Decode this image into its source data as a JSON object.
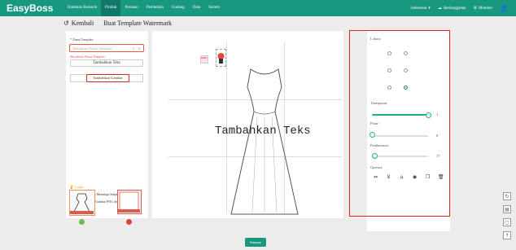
{
  "brand": "EasyBoss",
  "nav": [
    "Halaman Beranda",
    "Produk",
    "Pesanan",
    "Pembelian",
    "Gudang",
    "Data",
    "Sistem"
  ],
  "nav_active": 1,
  "right_nav": {
    "language": "Indonesia",
    "subscribe": "Berlanggahan",
    "member": "Member"
  },
  "header": {
    "back_label": "Kembali",
    "title": "Buat Template Watermark"
  },
  "left": {
    "name_label": "* Nama Template:",
    "name_placeholder": "Masukkan Nama Template",
    "name_counter": "0 / 30",
    "name_error": "Masukkan Nama Template",
    "add_text": "Tambahkan Teks",
    "add_image": "Tambahkan Gambar",
    "tips_title": "Cepat",
    "tips": [
      "1. Coba untuk Tidak Menutupi Subjek Produk dengan Tanda Air",
      "2. Unggah JPG dan Gambar PNG dengan Ukuran 2M"
    ]
  },
  "canvas": {
    "watermark_text": "Tambahkan Teks"
  },
  "right": {
    "location_label": "Lokasi:",
    "transparency_label": "Transparan:",
    "transparency_value": "1",
    "transparency_fraction": 1,
    "rotate_label": "Putar:",
    "rotate_value": "0",
    "rotate_fraction": 0,
    "scale_label": "Pembesaran:",
    "scale_value": "17",
    "scale_fraction": 0.05,
    "operations_label": "Operasi:"
  },
  "icons": [
    "flip-icon",
    "pin-icon",
    "lock-icon",
    "layer-icon",
    "copy-icon",
    "trash-icon"
  ],
  "save_label": "Simpan",
  "accent": "#18987f"
}
